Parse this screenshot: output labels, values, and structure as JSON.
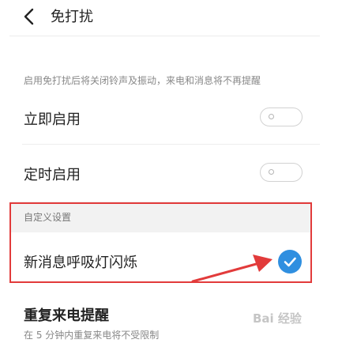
{
  "header": {
    "title": "免打扰"
  },
  "description": "启用免打扰后将关闭铃声及振动，来电和消息将不再提醒",
  "settings": [
    {
      "label": "立即启用",
      "enabled": false
    },
    {
      "label": "定时启用",
      "enabled": false
    }
  ],
  "custom_section": {
    "label": "自定义设置",
    "item_label": "新消息呼吸灯闪烁",
    "item_checked": true
  },
  "repeat_call": {
    "title": "重复来电提醒",
    "subtitle": "在 5 分钟内重复来电将不受限制"
  },
  "watermark": "Bai 经验",
  "colors": {
    "check_blue": "#2f8fe0",
    "highlight_red": "#e23b3b"
  },
  "icons": [
    "back-arrow-icon",
    "checkmark-icon"
  ]
}
